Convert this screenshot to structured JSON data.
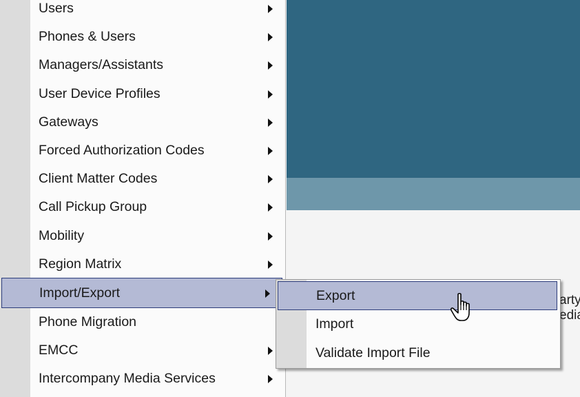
{
  "background": {
    "partial_text": "arty\nedia",
    "colors": {
      "dark": "#2f6681",
      "mid": "#6e97aa",
      "light": "#f4f4f4"
    }
  },
  "menu": {
    "items": [
      {
        "label": "Users",
        "has_submenu": true
      },
      {
        "label": "Phones & Users",
        "has_submenu": true
      },
      {
        "label": "Managers/Assistants",
        "has_submenu": true
      },
      {
        "label": "User Device Profiles",
        "has_submenu": true
      },
      {
        "label": "Gateways",
        "has_submenu": true
      },
      {
        "label": "Forced Authorization Codes",
        "has_submenu": true
      },
      {
        "label": "Client Matter Codes",
        "has_submenu": true
      },
      {
        "label": "Call Pickup Group",
        "has_submenu": true
      },
      {
        "label": "Mobility",
        "has_submenu": true
      },
      {
        "label": "Region Matrix",
        "has_submenu": true
      },
      {
        "label": "Import/Export",
        "has_submenu": true,
        "active": true
      },
      {
        "label": "Phone Migration",
        "has_submenu": false
      },
      {
        "label": "EMCC",
        "has_submenu": true
      },
      {
        "label": "Intercompany Media Services",
        "has_submenu": true
      }
    ]
  },
  "submenu": {
    "items": [
      {
        "label": "Export",
        "active": true
      },
      {
        "label": "Import"
      },
      {
        "label": "Validate Import File"
      }
    ]
  },
  "cursor": {
    "icon": "hand-pointer-icon"
  },
  "colors": {
    "highlight": "#b4bad5",
    "highlight_border": "#2b3b7a"
  }
}
